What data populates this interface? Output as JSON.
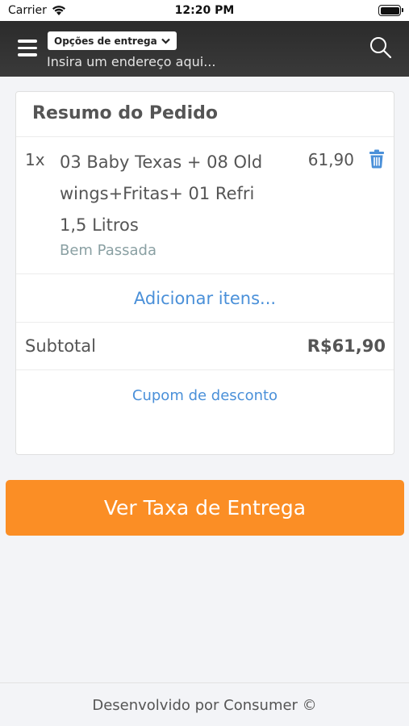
{
  "status_bar": {
    "carrier": "Carrier",
    "time": "12:20 PM"
  },
  "header": {
    "delivery_options_label": "Opções de entrega",
    "address_placeholder": "Insira um endereço aqui..."
  },
  "order_summary": {
    "title": "Resumo do Pedido",
    "items": [
      {
        "quantity": "1x",
        "name": "03 Baby Texas + 08 Old wings+Fritas+ 01 Refri 1,5 Litros",
        "note": "Bem Passada",
        "price": "61,90"
      }
    ],
    "add_items_label": "Adicionar itens...",
    "subtotal_label": "Subtotal",
    "subtotal_value": "R$61,90",
    "coupon_label": "Cupom de desconto"
  },
  "cta": {
    "label": "Ver Taxa de Entrega",
    "color": "#fb8e25"
  },
  "footer": {
    "text": "Desenvolvido por Consumer ©"
  },
  "colors": {
    "accent_link": "#4a90d9",
    "header_bg": "#333333"
  }
}
